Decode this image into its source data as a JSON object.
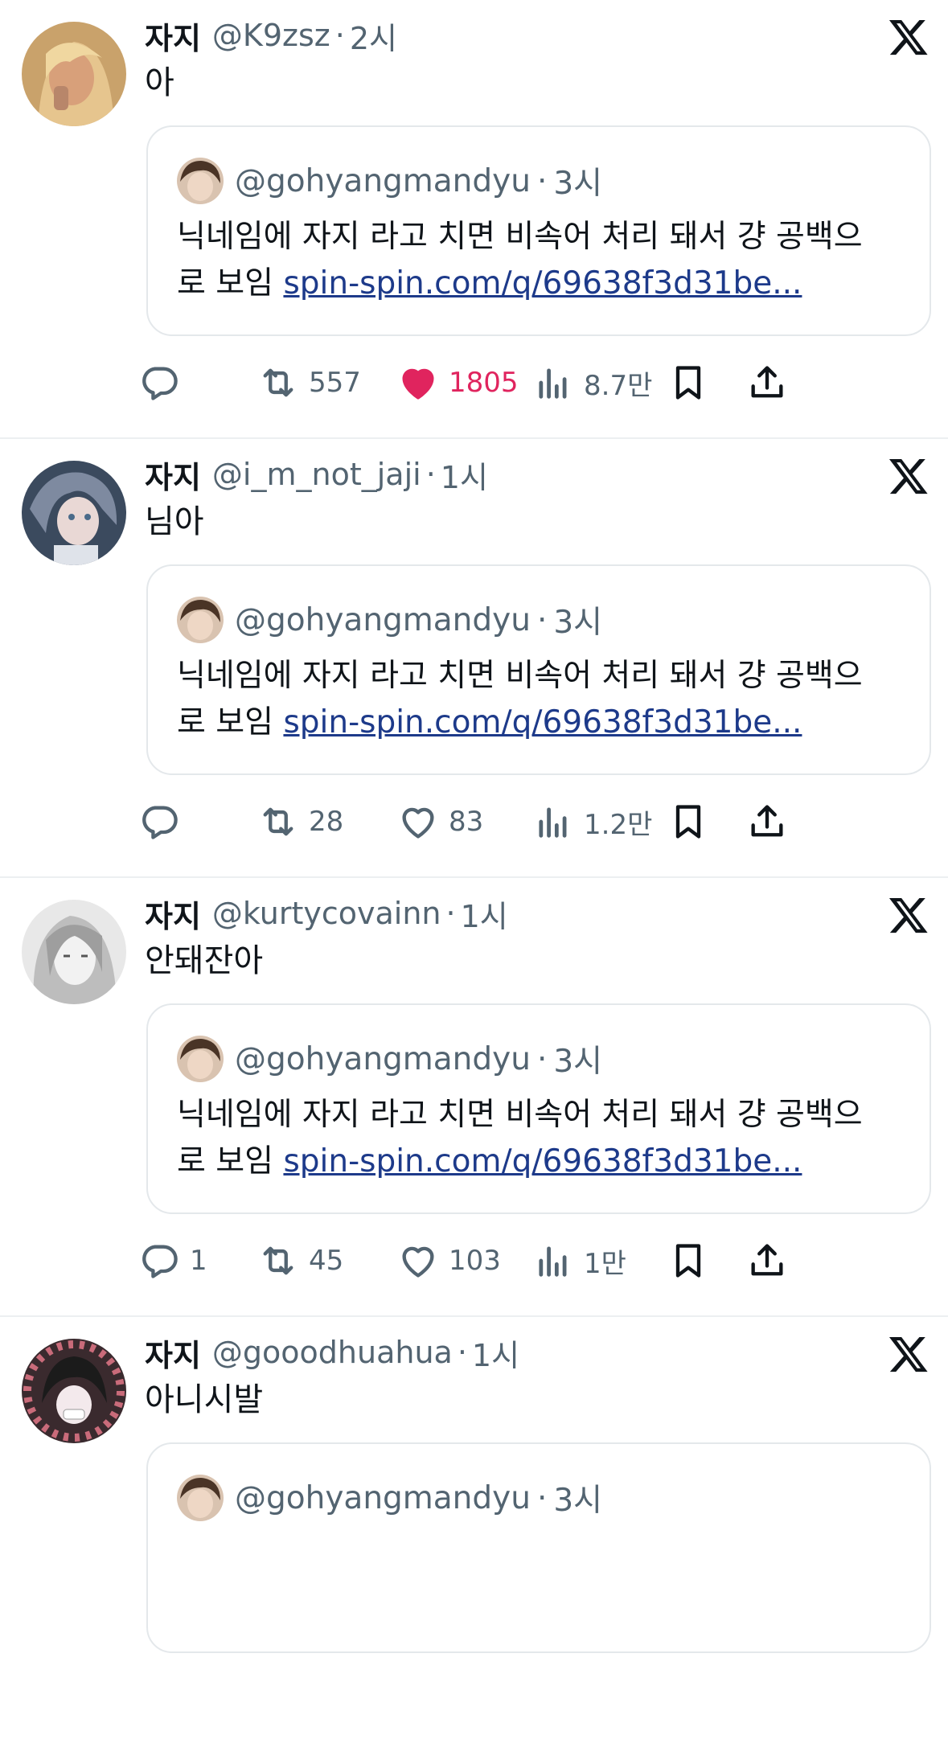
{
  "colors": {
    "like_active": "#e0245e",
    "muted": "#536471",
    "link": "#1d3a8a"
  },
  "quoted": {
    "handle": "@gohyangmandyu",
    "time": "3시",
    "text": "닉네임에 자지 라고 치면 비속어 처리 돼서 걍 공백으",
    "text2": "로 보임 ",
    "link": "spin-spin.com/q/69638f3d31be..."
  },
  "tweets": [
    {
      "name": "자지",
      "handle": "@K9zsz",
      "time": "2시",
      "text": "아",
      "replies": "",
      "retweets": "557",
      "likes": "1805",
      "liked": true,
      "views": "8.7만"
    },
    {
      "name": "자지",
      "handle": "@i_m_not_jaji",
      "time": "1시",
      "text": "님아",
      "replies": "",
      "retweets": "28",
      "likes": "83",
      "liked": false,
      "views": "1.2만"
    },
    {
      "name": "자지",
      "handle": "@kurtycovainn",
      "time": "1시",
      "text": "안돼잔아",
      "replies": "1",
      "retweets": "45",
      "likes": "103",
      "liked": false,
      "views": "1만"
    },
    {
      "name": "자지",
      "handle": "@gooodhuahua",
      "time": "1시",
      "text": "아니시발",
      "replies": "",
      "retweets": "",
      "likes": "",
      "liked": false,
      "views": ""
    }
  ],
  "icons": [
    "reply-icon",
    "retweet-icon",
    "like-icon",
    "views-icon",
    "bookmark-icon",
    "share-icon",
    "x-logo-icon"
  ]
}
